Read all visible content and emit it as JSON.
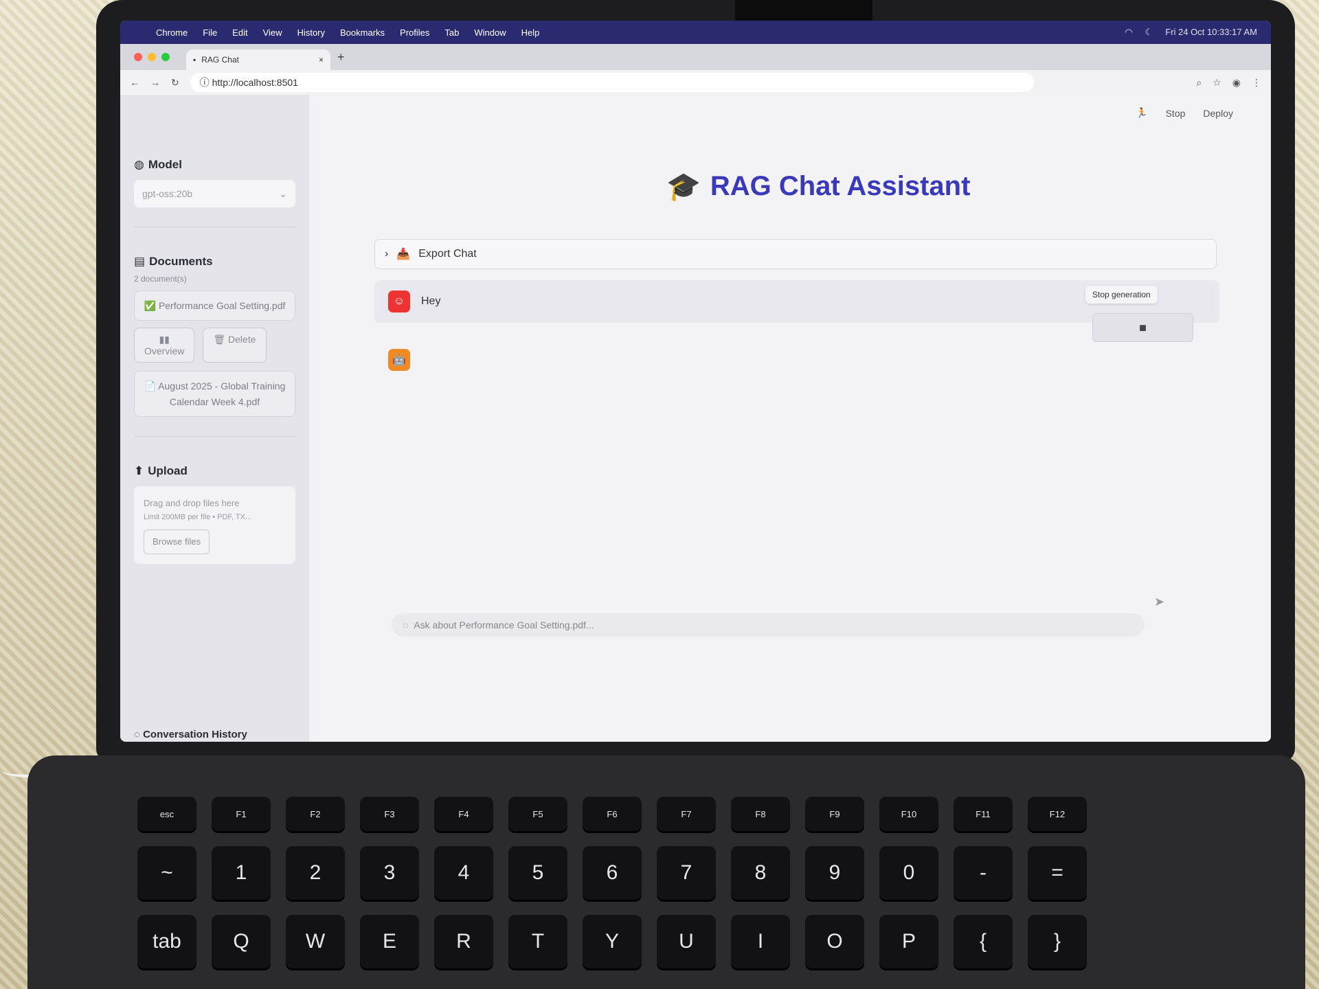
{
  "menubar": {
    "items": [
      "Chrome",
      "File",
      "Edit",
      "View",
      "History",
      "Bookmarks",
      "Profiles",
      "Tab",
      "Window",
      "Help"
    ],
    "clock": "Fri 24 Oct  10:33:17 AM"
  },
  "browser": {
    "tab_title": "RAG Chat",
    "tab_close": "×",
    "new_tab": "+",
    "url": "http://localhost:8501"
  },
  "app": {
    "topbar": {
      "stop_label": "Stop",
      "deploy_label": "Deploy"
    },
    "title": "RAG Chat Assistant",
    "sidebar": {
      "model_title": "Model",
      "model_value": "gpt-oss:20b",
      "documents_title": "Documents",
      "documents_count": "2 document(s)",
      "doc1_name": "Performance Goal Setting.pdf",
      "doc1_check": "✅",
      "overview_label": "Overview",
      "delete_label": "Delete",
      "doc2_name": "August 2025 - Global Training Calendar Week 4.pdf",
      "upload_title": "Upload",
      "upload_drag": "Drag and drop files here",
      "upload_limit": "Limit 200MB per file • PDF, TX...",
      "browse_label": "Browse files",
      "history_title": "Conversation History"
    },
    "export_label": "Export Chat",
    "user_message": "Hey",
    "tooltip": "Stop generation",
    "input_placeholder": "Ask about Performance Goal Setting.pdf..."
  },
  "keyboard": {
    "fkeys": [
      "esc",
      "F1",
      "F2",
      "F3",
      "F4",
      "F5",
      "F6",
      "F7",
      "F8",
      "F9",
      "F10",
      "F11",
      "F12"
    ],
    "number_row": [
      "~",
      "1",
      "2",
      "3",
      "4",
      "5",
      "6",
      "7",
      "8",
      "9",
      "0",
      "-",
      "="
    ],
    "letter_row": [
      "tab",
      "Q",
      "W",
      "E",
      "R",
      "T",
      "Y",
      "U",
      "I",
      "O",
      "P",
      "{",
      "}"
    ]
  },
  "colors": {
    "title": "#3a3ab8",
    "user_avatar": "#e33",
    "bot_avatar": "#f08a24"
  }
}
